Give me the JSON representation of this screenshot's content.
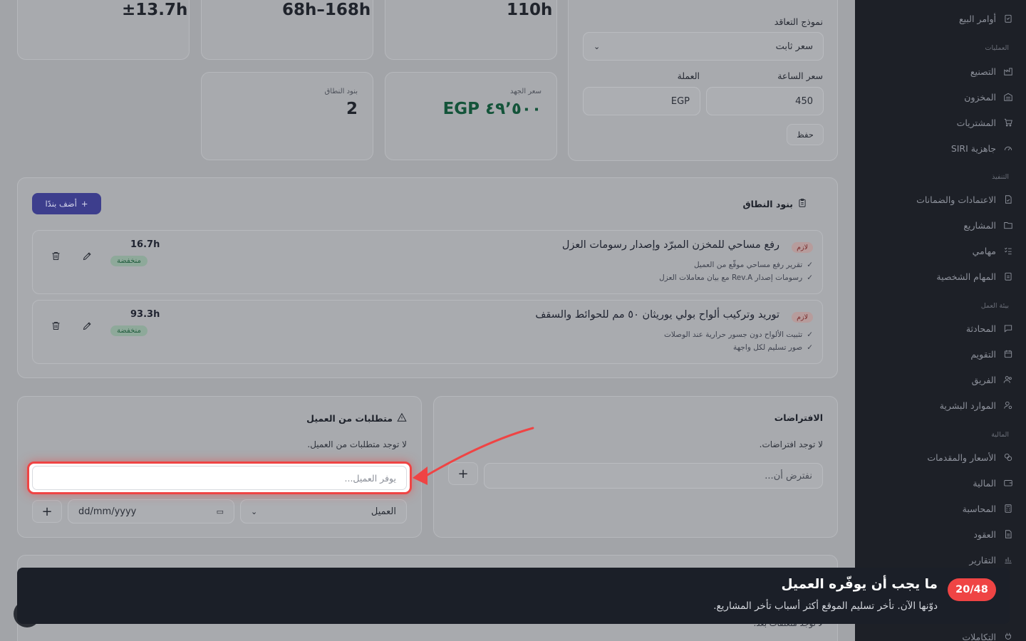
{
  "sidebar": {
    "items_top": [
      {
        "label": "أوامر البيع",
        "icon": "clipboard-icon"
      }
    ],
    "groups": [
      {
        "label": "العمليات",
        "items": [
          {
            "label": "التصنيع",
            "icon": "factory-icon"
          },
          {
            "label": "المخزون",
            "icon": "warehouse-icon"
          },
          {
            "label": "المشتريات",
            "icon": "cart-icon"
          },
          {
            "label": "جاهزية SIRI",
            "icon": "gauge-icon"
          }
        ]
      },
      {
        "label": "التنفيذ",
        "items": [
          {
            "label": "الاعتمادات والضمانات",
            "icon": "document-check-icon"
          },
          {
            "label": "المشاريع",
            "icon": "folder-icon"
          },
          {
            "label": "مهامي",
            "icon": "list-check-icon"
          },
          {
            "label": "المهام الشخصية",
            "icon": "clipboard-icon"
          }
        ]
      },
      {
        "label": "بيئة العمل",
        "items": [
          {
            "label": "المحادثة",
            "icon": "chat-icon"
          },
          {
            "label": "التقويم",
            "icon": "calendar-icon"
          },
          {
            "label": "الفريق",
            "icon": "users-icon"
          },
          {
            "label": "الموارد البشرية",
            "icon": "user-gear-icon"
          }
        ]
      },
      {
        "label": "المالية",
        "items": [
          {
            "label": "الأسعار والمقدمات",
            "icon": "coins-icon"
          },
          {
            "label": "المالية",
            "icon": "wallet-icon"
          },
          {
            "label": "المحاسبة",
            "icon": "calculator-icon"
          },
          {
            "label": "العقود",
            "icon": "contract-icon"
          },
          {
            "label": "التقارير",
            "icon": "bar-chart-icon"
          }
        ]
      }
    ],
    "item_bottom": {
      "label": "التكاملات",
      "icon": "plug-icon"
    }
  },
  "stats_top": {
    "a": "±13.7h",
    "b": "68h–168h",
    "c": "110h"
  },
  "stats_mid": {
    "scope_items_label": "بنود النطاق",
    "scope_items_value": "2",
    "effort_price_label": "سعر الجهد",
    "effort_price_value": "EGP ٤٩٬٥٠٠"
  },
  "contract": {
    "model_label": "نموذج التعاقد",
    "model_value": "سعر ثابت",
    "hour_rate_label": "سعر الساعة",
    "hour_rate_value": "450",
    "currency_label": "العملة",
    "currency_value": "EGP",
    "save_label": "حفظ"
  },
  "scope": {
    "title": "بنود النطاق",
    "add_label": "أضف بندًا",
    "items": [
      {
        "tag": "لازم",
        "title": "رفع مساحي للمخزن المبرّد وإصدار رسومات العزل",
        "bullets": [
          "تقرير رفع مساحي موقّع من العميل",
          "رسومات إصدار Rev.A مع بيان معاملات العزل"
        ],
        "hours": "16.7h",
        "risk": "منخفضة"
      },
      {
        "tag": "لازم",
        "title": "توريد وتركيب ألواح بولي يوريثان ٥٠ مم للحوائط والسقف",
        "bullets": [
          "تثبيت الألواح دون جسور حرارية عند الوصلات",
          "صور تسليم لكل واجهة"
        ],
        "hours": "93.3h",
        "risk": "منخفضة"
      }
    ]
  },
  "assumptions": {
    "title": "الافتراضات",
    "empty": "لا توجد افتراضات.",
    "placeholder": "نفترض أن..."
  },
  "client_reqs": {
    "title": "متطلبات من العميل",
    "empty": "لا توجد متطلبات من العميل.",
    "placeholder": "يوفر العميل...",
    "owner_value": "العميل",
    "date_placeholder": "dd/mm/yyyy"
  },
  "next_section_empty": "لا توجد متعلقات بعد.",
  "toast": {
    "count": "20/48",
    "title": "ما يجب أن يوفّره العميل",
    "body": "دوّنها الآن. تأخر تسليم الموقع أكثر أسباب تأخر المشاريع."
  },
  "colors": {
    "highlight": "#ef4444",
    "primary": "#3d3e8d",
    "toast_bg": "#1b1f28"
  }
}
